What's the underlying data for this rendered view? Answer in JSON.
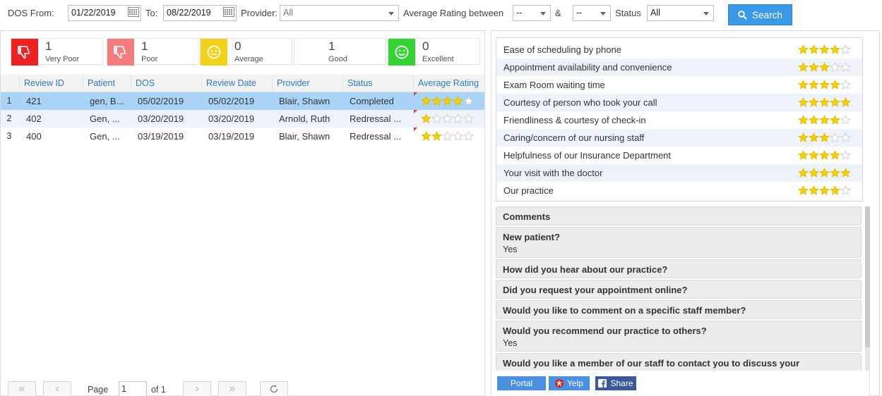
{
  "filters": {
    "dos_from_label": "DOS From:",
    "dos_from_value": "01/22/2019",
    "to_label": "To:",
    "to_value": "08/22/2019",
    "provider_label": "Provider:",
    "provider_value": "All",
    "avg_rating_label": "Average Rating between",
    "rating_min": "--",
    "and_label": "&",
    "rating_max": "--",
    "status_label": "Status",
    "status_value": "All",
    "search_label": "Search"
  },
  "summary": [
    {
      "count": "1",
      "label": "Very Poor",
      "color": "#ee2222",
      "icon": "thumbs-down-icon"
    },
    {
      "count": "1",
      "label": "Poor",
      "color": "#f47c7c",
      "icon": "thumbs-down-icon"
    },
    {
      "count": "0",
      "label": "Average",
      "color": "#f2d21a",
      "icon": "neutral-face-icon"
    },
    {
      "count": "1",
      "label": "Good",
      "color": "#ffffff",
      "icon": ""
    },
    {
      "count": "0",
      "label": "Excellent",
      "color": "#33d433",
      "icon": "smile-face-icon"
    }
  ],
  "grid": {
    "columns": [
      "Review ID",
      "Patient",
      "DOS",
      "Review Date",
      "Provider",
      "Status",
      "Average Rating"
    ],
    "rows": [
      {
        "num": "1",
        "review_id": "421",
        "patient": "gen, B...",
        "dos": "05/02/2019",
        "review_date": "05/02/2019",
        "provider": "Blair, Shawn",
        "status": "Completed",
        "rating": 4
      },
      {
        "num": "2",
        "review_id": "402",
        "patient": "Gen, ...",
        "dos": "03/20/2019",
        "review_date": "03/20/2019",
        "provider": "Arnold, Ruth",
        "status": "Redressal ...",
        "rating": 1
      },
      {
        "num": "3",
        "review_id": "400",
        "patient": "Gen, ...",
        "dos": "03/19/2019",
        "review_date": "03/19/2019",
        "provider": "Blair, Shawn",
        "status": "Redressal ...",
        "rating": 2
      }
    ]
  },
  "pager": {
    "page_label": "Page",
    "page_value": "1",
    "of_label": "of 1"
  },
  "ratings": [
    {
      "label": "Ease of scheduling by phone",
      "stars": 4
    },
    {
      "label": "Appointment availability and convenience",
      "stars": 3
    },
    {
      "label": "Exam Room waiting time",
      "stars": 4
    },
    {
      "label": "Courtesy of person who took your call",
      "stars": 5
    },
    {
      "label": "Friendliness & courtesy of check-in",
      "stars": 4
    },
    {
      "label": "Caring/concern of our nursing staff",
      "stars": 3
    },
    {
      "label": "Helpfulness of our Insurance Department",
      "stars": 4
    },
    {
      "label": "Your visit with the doctor",
      "stars": 5
    },
    {
      "label": "Our practice",
      "stars": 4
    }
  ],
  "questions": [
    {
      "q": "Comments",
      "a": ""
    },
    {
      "q": "New patient?",
      "a": "Yes"
    },
    {
      "q": "How did you hear about our practice?",
      "a": ""
    },
    {
      "q": "Did you request your appointment online?",
      "a": ""
    },
    {
      "q": "Would you like to comment on a specific staff member?",
      "a": ""
    },
    {
      "q": "Would you recommend our practice to others?",
      "a": "Yes"
    },
    {
      "q": "Would you like a member of our staff to contact you to discuss your",
      "a": ""
    }
  ],
  "share": {
    "portal_label": "Portal",
    "yelp_label": "Yelp",
    "facebook_label": "Share"
  },
  "colors": {
    "accent": "#3a9ae8",
    "selected_row": "#aad4f7",
    "star_fill": "#f4d000",
    "portal": "#4a90e2",
    "yelp": "#d32323",
    "facebook": "#3b5998"
  }
}
